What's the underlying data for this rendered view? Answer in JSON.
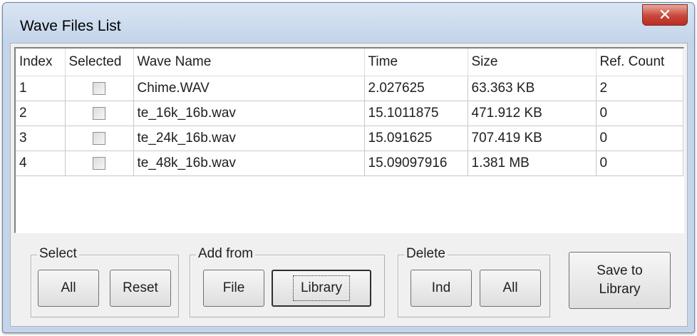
{
  "window": {
    "title": "Wave Files List"
  },
  "columns": [
    "Index",
    "Selected",
    "Wave Name",
    "Time",
    "Size",
    "Ref. Count"
  ],
  "rows": [
    {
      "index": "1",
      "selected": false,
      "name": "Chime.WAV",
      "time": "2.027625",
      "size": "63.363 KB",
      "ref_count": "2"
    },
    {
      "index": "2",
      "selected": false,
      "name": "te_16k_16b.wav",
      "time": "15.1011875",
      "size": "471.912 KB",
      "ref_count": "0"
    },
    {
      "index": "3",
      "selected": false,
      "name": "te_24k_16b.wav",
      "time": "15.091625",
      "size": "707.419 KB",
      "ref_count": "0"
    },
    {
      "index": "4",
      "selected": false,
      "name": "te_48k_16b.wav",
      "time": "15.09097916",
      "size": "1.381 MB",
      "ref_count": "0"
    }
  ],
  "select_group": {
    "label": "Select",
    "all": "All",
    "reset": "Reset"
  },
  "add_group": {
    "label": "Add from",
    "file": "File",
    "library": "Library"
  },
  "delete_group": {
    "label": "Delete",
    "ind": "Ind",
    "all": "All"
  },
  "save_button": {
    "line1": "Save to",
    "line2": "Library"
  }
}
